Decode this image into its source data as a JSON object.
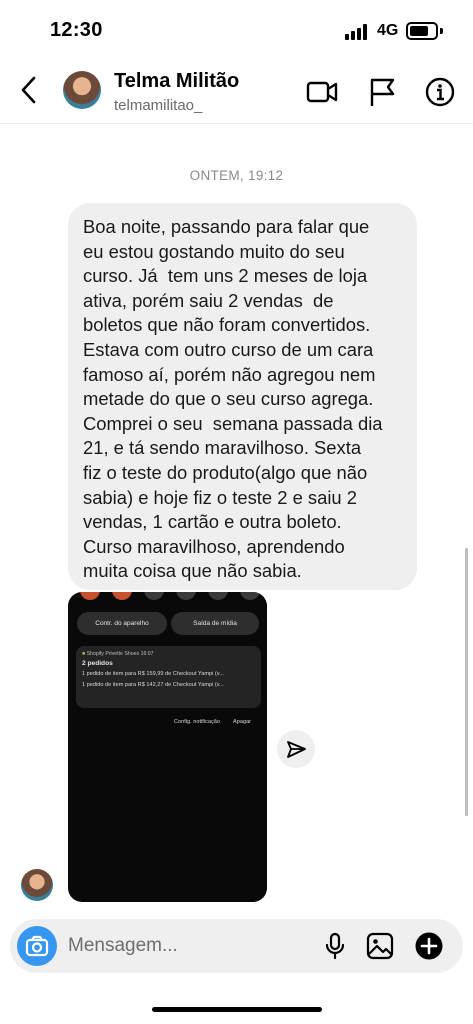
{
  "status_bar": {
    "time": "12:30",
    "network": "4G",
    "battery_level": 0.75
  },
  "header": {
    "name": "Telma Militão",
    "username": "telmamilitao_",
    "icons": [
      "back-chevron-icon",
      "video-call-icon",
      "flag-icon",
      "info-icon"
    ]
  },
  "chat": {
    "date_separator": "ONTEM, 19:12",
    "message_lines": [
      "Boa noite, passando para falar que",
      "eu estou gostando muito do seu",
      "curso. Já  tem uns 2 meses de loja",
      "ativa, porém saiu 2 vendas  de",
      "boletos que não foram convertidos.",
      "Estava com outro curso de um cara",
      "famoso aí, porém não agregou nem",
      "metade do que o seu curso agrega.",
      "Comprei o seu  semana passada dia",
      "21, e tá sendo maravilhoso. Sexta",
      "fiz o teste do produto(algo que não",
      "sabia) e hoje fiz o teste 2 e saiu 2",
      "vendas, 1 cartão e outra boleto.",
      "Curso maravilhoso, aprendendo",
      "muita coisa que não sabia."
    ],
    "screenshot": {
      "quick_settings": [
        "Contr. do aparelho",
        "Saída de mídia"
      ],
      "notification": {
        "app": "Shopify",
        "store": "Privette Shoes",
        "time": "16:07",
        "title": "2 pedidos",
        "lines": [
          "1 pedido de item para R$ 159,99 de Checkout Yampi (v...",
          "1 pedido de item para R$ 142,27 de Checkout Yampi (v..."
        ]
      },
      "actions": [
        "Config. notificação",
        "Apagar"
      ]
    }
  },
  "composer": {
    "placeholder": "Mensagem...",
    "icons": [
      "camera-icon",
      "microphone-icon",
      "gallery-icon",
      "add-icon"
    ]
  },
  "colors": {
    "accent": "#3797f0",
    "bubble": "#efefef",
    "screenshot_bg": "#090909"
  }
}
